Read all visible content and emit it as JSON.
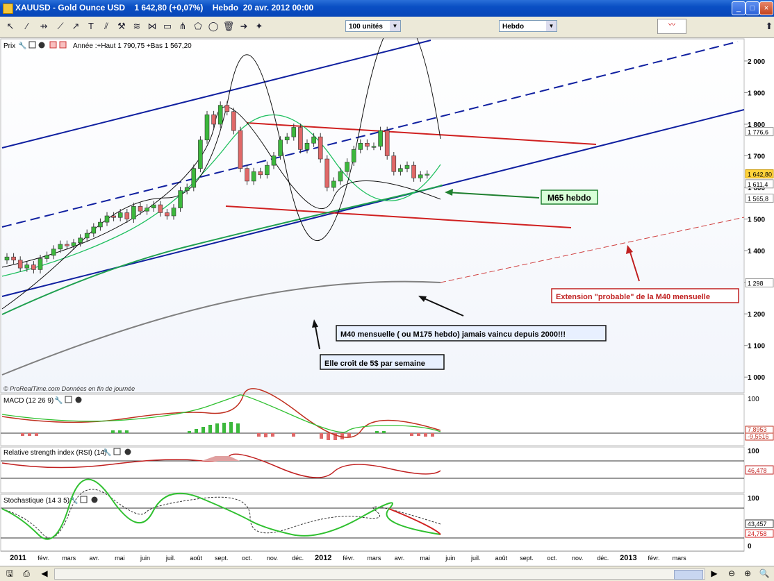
{
  "window": {
    "title": "XAUUSD - Gold Ounce USD    1 642,80 (+0,07%)    Hebdo  20 avr. 2012 00:00"
  },
  "toolbar": {
    "units_combo": "100 unités",
    "period_combo": "Hebdo"
  },
  "price_panel": {
    "label": "Prix",
    "stats": "Année :+Haut 1 790,75 +Bas 1 567,20",
    "source": "© ProRealTime.com  Données en fin de journée"
  },
  "macd_panel": {
    "label": "MACD (12 26 9)",
    "value1": "7,8953",
    "value2": "-9,5516"
  },
  "rsi_panel": {
    "label": "Relative strength index (RSI) (14)",
    "value": "46,478"
  },
  "stoch_panel": {
    "label": "Stochastique (14 3 5)",
    "value1": "43,457",
    "value2": "24,758"
  },
  "annotations": {
    "m65": "M65 hebdo",
    "extension": "Extension \"probable\" de la M40 mensuelle",
    "m40": "M40 mensuelle ( ou M175 hebdo) jamais vaincu depuis 2000!!!",
    "growth": "Elle croît de 5$ par semaine"
  },
  "colors": {
    "up": "#3cb83c",
    "down": "#e06868",
    "channel": "#1020a0",
    "resistance": "#d02020",
    "m40": "#808080",
    "ema": "#20a050",
    "stoch_k": "#30c030",
    "stoch_d_line": "#d02020"
  },
  "chart_data": {
    "type": "candlestick",
    "y_axis": {
      "ylim": [
        950,
        2070
      ],
      "ticks": [
        "2 000",
        "1 900",
        "1 800",
        "1 700",
        "1 600",
        "1 500",
        "1 400",
        "1 300",
        "1 200",
        "1 100",
        "1 000"
      ]
    },
    "y_markers": [
      {
        "label": "1 776,6",
        "value": 1776.6
      },
      {
        "label": "1 642,80",
        "value": 1642.8
      },
      {
        "label": "1 611,4",
        "value": 1611.4
      },
      {
        "label": "1 565,8",
        "value": 1565.8
      },
      {
        "label": "1 298",
        "value": 1298
      }
    ],
    "x_axis": {
      "ticks": [
        "2011",
        "févr.",
        "mars",
        "avr.",
        "mai",
        "juin",
        "juil.",
        "août",
        "sept.",
        "oct.",
        "nov.",
        "déc.",
        "2012",
        "févr.",
        "mars",
        "avr.",
        "mai",
        "juin",
        "juil.",
        "août",
        "sept.",
        "oct.",
        "nov.",
        "déc.",
        "2013",
        "févr.",
        "mars"
      ]
    },
    "closes": [
      1380,
      1370,
      1345,
      1355,
      1340,
      1375,
      1385,
      1405,
      1420,
      1415,
      1425,
      1440,
      1455,
      1475,
      1490,
      1510,
      1505,
      1520,
      1500,
      1540,
      1525,
      1535,
      1545,
      1520,
      1510,
      1535,
      1590,
      1600,
      1660,
      1750,
      1830,
      1800,
      1860,
      1840,
      1780,
      1660,
      1620,
      1650,
      1640,
      1670,
      1700,
      1750,
      1760,
      1790,
      1720,
      1740,
      1760,
      1690,
      1600,
      1620,
      1650,
      1680,
      1720,
      1740,
      1730,
      1730,
      1780,
      1700,
      1650,
      1660,
      1670,
      1630,
      1640,
      1642
    ]
  },
  "macd_data": {
    "ylim": [
      -30,
      110
    ],
    "tick": "100"
  },
  "rsi_data": {
    "ylim": [
      0,
      100
    ],
    "tick": "100"
  },
  "stoch_data": {
    "ylim": [
      0,
      100
    ],
    "ticks": [
      "100",
      "0"
    ]
  }
}
